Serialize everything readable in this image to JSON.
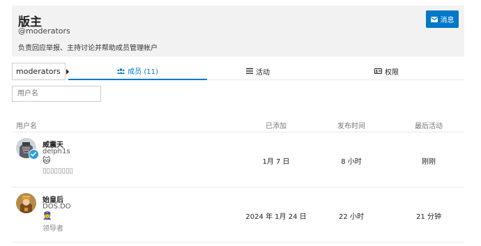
{
  "group": {
    "title": "版主",
    "handle": "@moderators",
    "description": "负责回应举报、主持讨论并帮助成员管理帐户",
    "message_button": "消息"
  },
  "selector": {
    "value": "moderators"
  },
  "tabs": [
    {
      "label": "成员 (11)",
      "icon": "users-icon",
      "active": true
    },
    {
      "label": "活动",
      "icon": "list-icon",
      "active": false
    },
    {
      "label": "权限",
      "icon": "id-card-icon",
      "active": false
    }
  ],
  "filter": {
    "placeholder": "用户名"
  },
  "table": {
    "headers": {
      "user": "用户名",
      "added": "已添加",
      "posted": "发布时间",
      "last": "最后活动"
    },
    "rows": [
      {
        "name": "威震天",
        "handle": "delph1s",
        "status_emoji": "🐱",
        "title": "▯▯▯▯▯▯▯▯",
        "added": "1月 7 日",
        "posted": "8 小时",
        "last": "刚刚"
      },
      {
        "name": "始皇后",
        "handle": "DOS.DO",
        "status_emoji": "👮",
        "title": "领导者",
        "added": "2024 年 1月 24 日",
        "posted": "22 小时",
        "last": "21 分钟"
      }
    ]
  },
  "colors": {
    "accent": "#0077c8",
    "verified": "#29a1d7",
    "header_bg": "#f2f2f2"
  }
}
